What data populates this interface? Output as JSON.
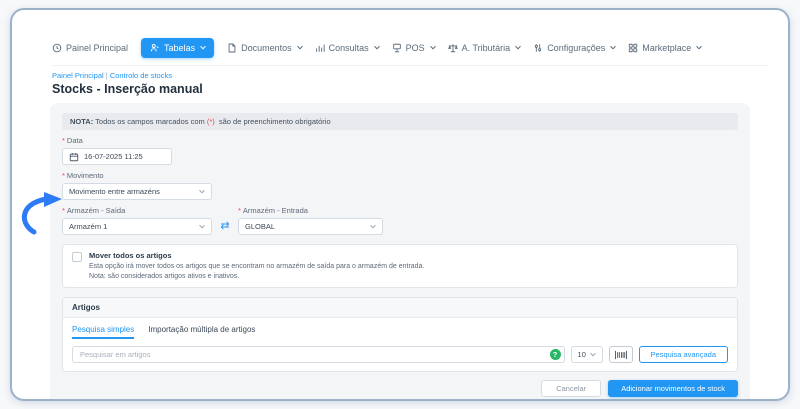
{
  "nav": {
    "items": [
      {
        "label": "Painel Principal",
        "icon": "dashboard-icon"
      },
      {
        "label": "Tabelas",
        "icon": "tables-icon"
      },
      {
        "label": "Documentos",
        "icon": "documents-icon"
      },
      {
        "label": "Consultas",
        "icon": "reports-icon"
      },
      {
        "label": "POS",
        "icon": "pos-icon"
      },
      {
        "label": "A. Tributária",
        "icon": "tax-icon"
      },
      {
        "label": "Configurações",
        "icon": "settings-icon"
      },
      {
        "label": "Marketplace",
        "icon": "marketplace-icon"
      }
    ],
    "active": "Tabelas"
  },
  "breadcrumb": {
    "home": "Painel Principal",
    "separator": "|",
    "current": "Controlo de stocks"
  },
  "page_title": "Stocks - Inserção manual",
  "note": {
    "label": "NOTA:",
    "before": " Todos os campos marcados com ",
    "marker": "(*)",
    "after": " são de preenchimento obrigatório"
  },
  "form": {
    "required_marker": "*",
    "date": {
      "label": "Data",
      "value": "16-07-2025 11:25"
    },
    "movement": {
      "label": "Movimento",
      "value": "Movimento entre armazéns"
    },
    "warehouse_out": {
      "label": "Armazém - Saída",
      "value": "Armazém 1"
    },
    "warehouse_in": {
      "label": "Armazém - Entrada",
      "value": "GLOBAL"
    },
    "move_all": {
      "title": "Mover todos os artigos",
      "description": "Esta opção irá mover todos os artigos que se encontram no armazém de saída para o armazém de entrada.",
      "note": "Nota: são considerados artigos ativos e inativos.",
      "checked": false
    }
  },
  "articles": {
    "title": "Artigos",
    "tabs": {
      "simple": "Pesquisa simples",
      "import": "Importação múltipla de artigos",
      "active": "Pesquisa simples"
    },
    "search": {
      "placeholder": "Pesquisar em artigos",
      "help_badge": "?"
    },
    "page_size": "10",
    "advanced_search_label": "Pesquisa avançada"
  },
  "actions": {
    "cancel": "Cancelar",
    "submit": "Adicionar movimentos de stock"
  },
  "colors": {
    "accent": "#2196f3",
    "required": "#e5484d",
    "help_badge": "#27b566",
    "annotation_arrow": "#2e7bf6",
    "panel_border": "#9db1c9"
  }
}
